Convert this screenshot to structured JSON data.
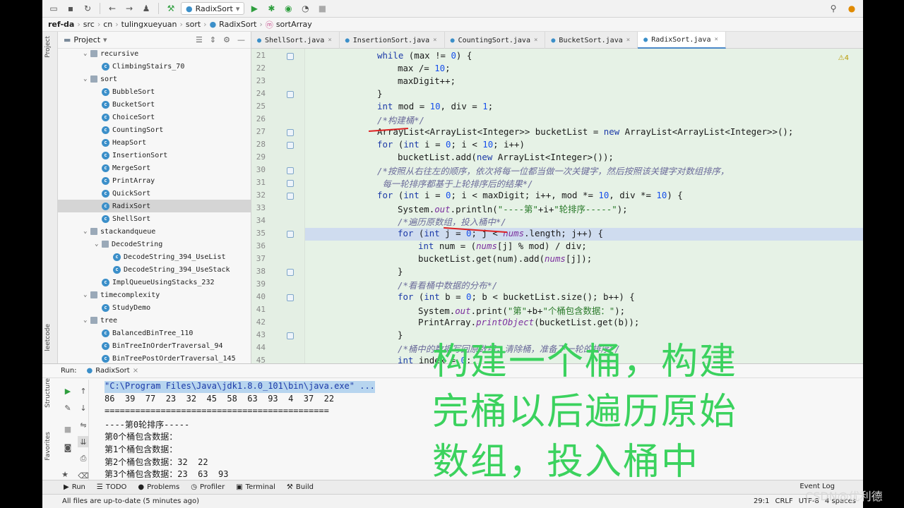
{
  "toolbar": {
    "run_config": "RadixSort"
  },
  "breadcrumb": [
    "ref-da",
    "src",
    "cn",
    "tulingxueyuan",
    "sort",
    "RadixSort",
    "sortArray"
  ],
  "project": {
    "title": "Project",
    "items": [
      {
        "label": "recursive",
        "indent": 1,
        "kind": "folder",
        "open": true
      },
      {
        "label": "ClimbingStairs_70",
        "indent": 2,
        "kind": "class"
      },
      {
        "label": "sort",
        "indent": 1,
        "kind": "folder",
        "open": true
      },
      {
        "label": "BubbleSort",
        "indent": 2,
        "kind": "class"
      },
      {
        "label": "BucketSort",
        "indent": 2,
        "kind": "class"
      },
      {
        "label": "ChoiceSort",
        "indent": 2,
        "kind": "class"
      },
      {
        "label": "CountingSort",
        "indent": 2,
        "kind": "class"
      },
      {
        "label": "HeapSort",
        "indent": 2,
        "kind": "class"
      },
      {
        "label": "InsertionSort",
        "indent": 2,
        "kind": "class"
      },
      {
        "label": "MergeSort",
        "indent": 2,
        "kind": "class"
      },
      {
        "label": "PrintArray",
        "indent": 2,
        "kind": "class"
      },
      {
        "label": "QuickSort",
        "indent": 2,
        "kind": "class"
      },
      {
        "label": "RadixSort",
        "indent": 2,
        "kind": "class",
        "selected": true
      },
      {
        "label": "ShellSort",
        "indent": 2,
        "kind": "class"
      },
      {
        "label": "stackandqueue",
        "indent": 1,
        "kind": "folder",
        "open": true
      },
      {
        "label": "DecodeString",
        "indent": 2,
        "kind": "folder",
        "open": true
      },
      {
        "label": "DecodeString_394_UseList",
        "indent": 3,
        "kind": "class"
      },
      {
        "label": "DecodeString_394_UseStack",
        "indent": 3,
        "kind": "class"
      },
      {
        "label": "ImplQueueUsingStacks_232",
        "indent": 2,
        "kind": "class"
      },
      {
        "label": "timecomplexity",
        "indent": 1,
        "kind": "folder",
        "open": true
      },
      {
        "label": "StudyDemo",
        "indent": 2,
        "kind": "class"
      },
      {
        "label": "tree",
        "indent": 1,
        "kind": "folder",
        "open": true
      },
      {
        "label": "BalancedBinTree_110",
        "indent": 2,
        "kind": "class"
      },
      {
        "label": "BinTreeInOrderTraversal_94",
        "indent": 2,
        "kind": "class"
      },
      {
        "label": "BinTreePostOrderTraversal_145",
        "indent": 2,
        "kind": "class"
      }
    ]
  },
  "side_tabs": {
    "project": "Project",
    "leetcode": "leetcode",
    "structure": "Structure",
    "favorites": "Favorites"
  },
  "tabs": [
    {
      "label": "ShellSort.java"
    },
    {
      "label": "InsertionSort.java"
    },
    {
      "label": "CountingSort.java"
    },
    {
      "label": "BucketSort.java"
    },
    {
      "label": "RadixSort.java",
      "active": true
    }
  ],
  "editor": {
    "warning": "⚠4",
    "lines": [
      {
        "n": "21",
        "html": "<span class='kw'>while</span> (max != <span class='num'>0</span>) {",
        "indent": 0
      },
      {
        "n": "22",
        "html": "max /= <span class='num'>10</span>;",
        "indent": 1
      },
      {
        "n": "23",
        "html": "maxDigit++;",
        "indent": 1
      },
      {
        "n": "24",
        "html": "}",
        "indent": 0
      },
      {
        "n": "25",
        "html": "<span class='kw'>int</span> mod = <span class='num'>10</span>, div = <span class='num'>1</span>;",
        "indent": 0
      },
      {
        "n": "26",
        "html": "<span class='cm'>/*构建桶*/</span>",
        "indent": 0
      },
      {
        "n": "27",
        "html": "ArrayList&lt;ArrayList&lt;Integer&gt;&gt; bucketList = <span class='kw'>new</span> ArrayList&lt;ArrayList&lt;Integer&gt;&gt;();",
        "indent": 0
      },
      {
        "n": "28",
        "html": "<span class='kw'>for</span> (<span class='kw'>int</span> i = <span class='num'>0</span>; i &lt; <span class='num'>10</span>; i++)",
        "indent": 0
      },
      {
        "n": "29",
        "html": "bucketList.add(<span class='kw'>new</span> ArrayList&lt;Integer&gt;());",
        "indent": 1
      },
      {
        "n": "30",
        "html": "<span class='cm'>/*按照从右往左的顺序，依次将每一位都当做一次关键字，然后按照该关键字对数组排序，</span>",
        "indent": 0
      },
      {
        "n": "31",
        "html": "<span class='cm'> 每一轮排序都基于上轮排序后的结果*/</span>",
        "indent": 0
      },
      {
        "n": "32",
        "html": "<span class='kw'>for</span> (<span class='kw'>int</span> i = <span class='num'>0</span>; i &lt; maxDigit; i++, mod *= <span class='num'>10</span>, div *= <span class='num'>10</span>) {",
        "indent": 0
      },
      {
        "n": "33",
        "html": "System.<span class='fld'>out</span>.println(<span class='str'>\"----第\"</span>+i+<span class='str'>\"轮排序-----\"</span>);",
        "indent": 1
      },
      {
        "n": "34",
        "html": "<span class='cm'>/*遍历原数组，投入桶中*/</span>",
        "indent": 1
      },
      {
        "n": "35",
        "html": "<span class='kw'>for</span> (<span class='kw'>int</span> j = <span class='num'>0</span>; j &lt; <span class='fld'>nums</span>.length; j++) {",
        "indent": 1
      },
      {
        "n": "36",
        "html": "<span class='kw'>int</span> num = (<span class='fld'>nums</span>[j] % mod) / div;",
        "indent": 2
      },
      {
        "n": "37",
        "html": "bucketList.get(num).add(<span class='fld'>nums</span>[j]);",
        "indent": 2
      },
      {
        "n": "38",
        "html": "}",
        "indent": 1
      },
      {
        "n": "39",
        "html": "<span class='cm'>/*看看桶中数据的分布*/</span>",
        "indent": 1
      },
      {
        "n": "40",
        "html": "<span class='kw'>for</span> (<span class='kw'>int</span> b = <span class='num'>0</span>; b &lt; bucketList.size(); b++) {",
        "indent": 1
      },
      {
        "n": "41",
        "html": "System.<span class='fld'>out</span>.print(<span class='str'>\"第\"</span>+b+<span class='str'>\"个桶包含数据：\"</span>);",
        "indent": 2
      },
      {
        "n": "42",
        "html": "PrintArray.<span class='fld'>printObject</span>(bucketList.get(b));",
        "indent": 2
      },
      {
        "n": "43",
        "html": "}",
        "indent": 1
      },
      {
        "n": "44",
        "html": "<span class='cm'>/*桶中的数据写回原数组，清除桶，准备下一轮的排序*/</span>",
        "indent": 1
      },
      {
        "n": "45",
        "html": "<span class='kw'>int</span> index = <span class='num'>0</span>;",
        "indent": 1
      }
    ]
  },
  "run": {
    "label": "Run:",
    "tab": "RadixSort",
    "console": [
      {
        "text": "\"C:\\Program Files\\Java\\jdk1.8.0_101\\bin\\java.exe\" ...",
        "cmd": true
      },
      {
        "text": "86  39  77  23  32  45  58  63  93  4  37  22"
      },
      {
        "text": "============================================"
      },
      {
        "text": "----第0轮排序-----"
      },
      {
        "text": "第0个桶包含数据："
      },
      {
        "text": "第1个桶包含数据："
      },
      {
        "text": "第2个桶包含数据：32  22"
      },
      {
        "text": "第3个桶包含数据：23  63  93"
      }
    ]
  },
  "bottom_tabs": [
    {
      "icon": "▶",
      "label": "Run"
    },
    {
      "icon": "☰",
      "label": "TODO"
    },
    {
      "icon": "●",
      "label": "Problems"
    },
    {
      "icon": "◷",
      "label": "Profiler"
    },
    {
      "icon": "▣",
      "label": "Terminal"
    },
    {
      "icon": "⚒",
      "label": "Build"
    }
  ],
  "event_log": "Event Log",
  "status": {
    "left": "All files are up-to-date (5 minutes ago)",
    "pos": "29:1",
    "eol": "CRLF",
    "enc": "UTF-8",
    "indent": "4 spaces"
  },
  "overlay": [
    "构建一个桶，构建",
    "完桶以后遍历原始",
    "数组，投入桶中"
  ],
  "watermark": "CSDN@优利德"
}
